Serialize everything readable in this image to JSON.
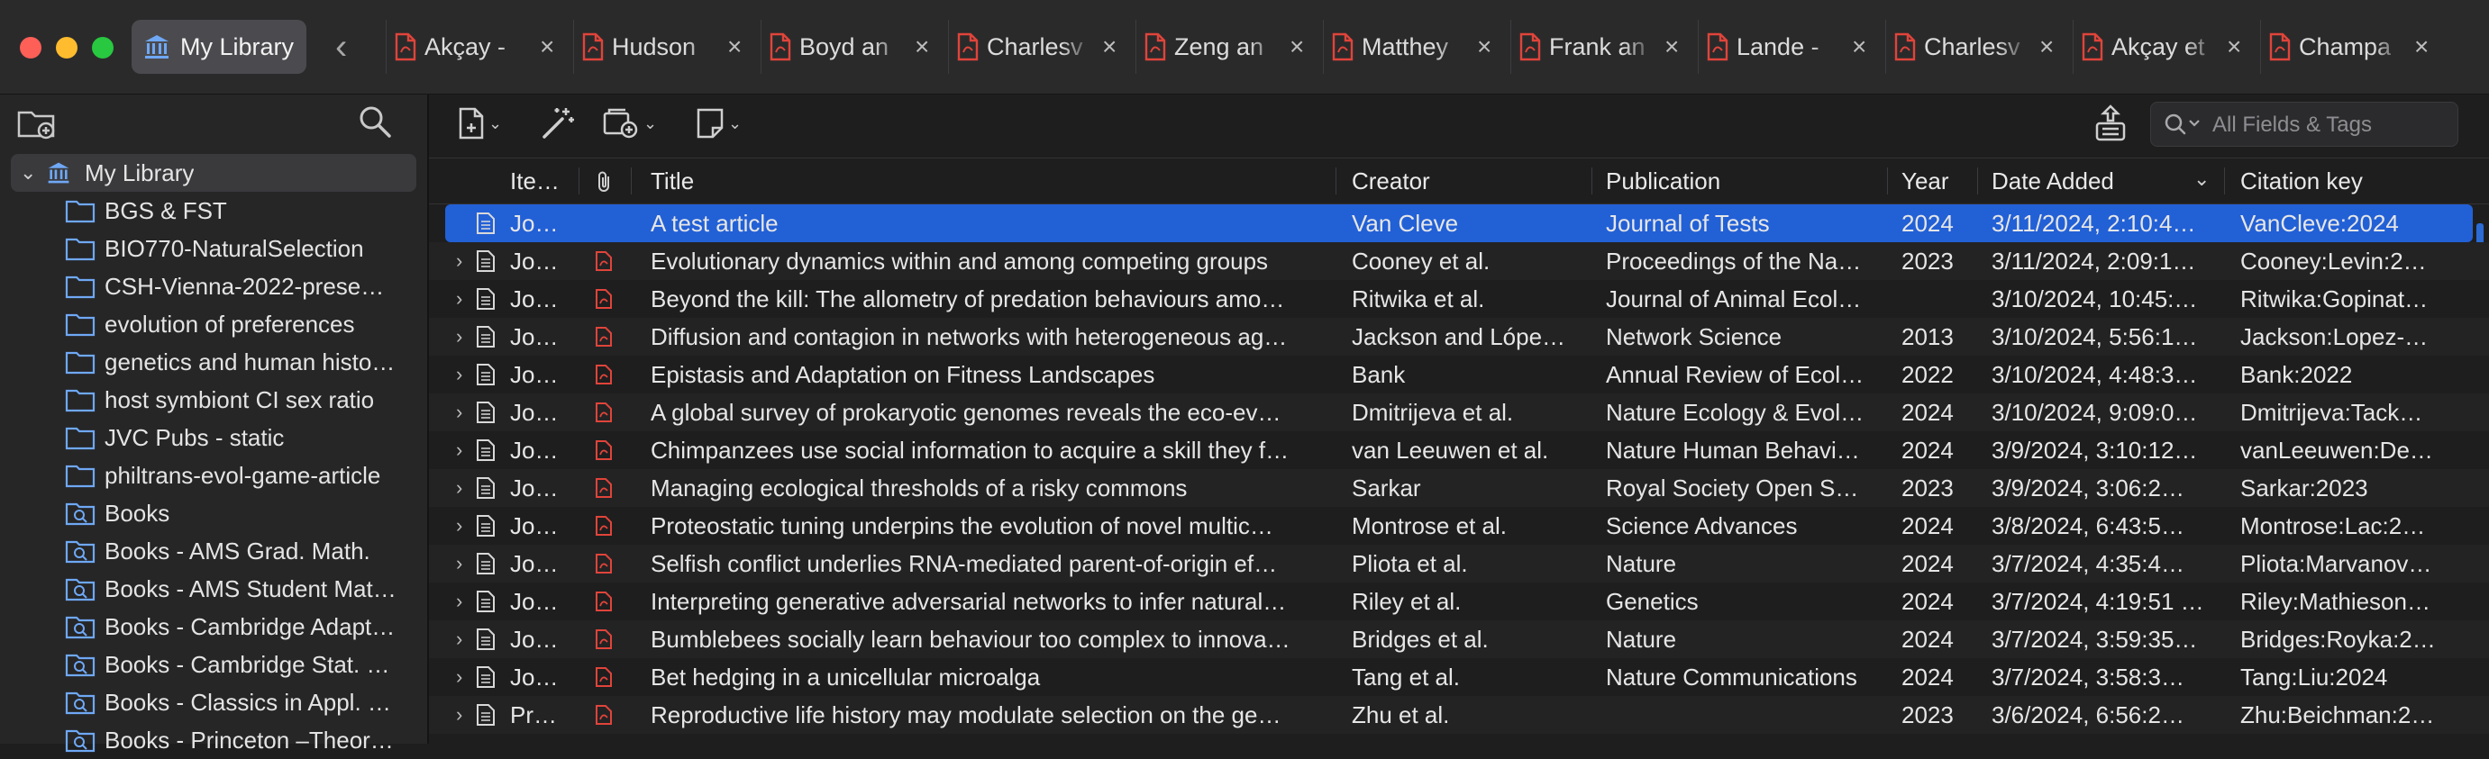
{
  "window": {
    "library_tab_label": "My Library",
    "tabs": [
      {
        "label": "Akçay - "
      },
      {
        "label": "Hudson"
      },
      {
        "label": "Boyd an"
      },
      {
        "label": "Charlesv"
      },
      {
        "label": "Zeng an"
      },
      {
        "label": "Matthey"
      },
      {
        "label": "Frank an"
      },
      {
        "label": "Lande - "
      },
      {
        "label": "Charlesv"
      },
      {
        "label": "Akçay et"
      },
      {
        "label": "Champa"
      }
    ]
  },
  "sidebar": {
    "root_label": "My Library",
    "items": [
      {
        "label": "BGS & FST",
        "icon": "folder-icon"
      },
      {
        "label": "BIO770-NaturalSelection",
        "icon": "folder-icon"
      },
      {
        "label": "CSH-Vienna-2022-prese…",
        "icon": "folder-icon"
      },
      {
        "label": "evolution of preferences",
        "icon": "folder-icon"
      },
      {
        "label": "genetics and human histo…",
        "icon": "folder-icon"
      },
      {
        "label": "host symbiont CI sex ratio",
        "icon": "folder-icon"
      },
      {
        "label": "JVC Pubs - static",
        "icon": "folder-icon"
      },
      {
        "label": "philtrans-evol-game-article",
        "icon": "folder-icon"
      },
      {
        "label": "Books",
        "icon": "saved-search-icon"
      },
      {
        "label": "Books - AMS Grad. Math.",
        "icon": "saved-search-icon"
      },
      {
        "label": "Books - AMS Student Mat…",
        "icon": "saved-search-icon"
      },
      {
        "label": "Books - Cambridge Adapt…",
        "icon": "saved-search-icon"
      },
      {
        "label": "Books - Cambridge Stat. …",
        "icon": "saved-search-icon"
      },
      {
        "label": "Books - Classics in Appl. …",
        "icon": "saved-search-icon"
      },
      {
        "label": "Books - Princeton –Theor…",
        "icon": "saved-search-icon"
      }
    ]
  },
  "search": {
    "placeholder": "All Fields & Tags"
  },
  "columns": {
    "item_type": "Ite…",
    "title": "Title",
    "creator": "Creator",
    "publication": "Publication",
    "year": "Year",
    "date_added": "Date Added",
    "citation_key": "Citation key"
  },
  "rows": [
    {
      "type": "Jo…",
      "title": "A test article",
      "creator": "Van Cleve",
      "publication": "Journal of Tests",
      "year": "2024",
      "date_added": "3/11/2024, 2:10:4…",
      "citation_key": "VanCleve:2024"
    },
    {
      "type": "Jo…",
      "title": "Evolutionary dynamics within and among competing groups",
      "creator": "Cooney et al.",
      "publication": "Proceedings of the Na…",
      "year": "2023",
      "date_added": "3/11/2024, 2:09:1…",
      "citation_key": "Cooney:Levin:2…"
    },
    {
      "type": "Jo…",
      "title": "Beyond the kill: The allometry of predation behaviours amo…",
      "creator": "Ritwika et al.",
      "publication": "Journal of Animal Ecol…",
      "year": "",
      "date_added": "3/10/2024, 10:45:…",
      "citation_key": "Ritwika:Gopinat…"
    },
    {
      "type": "Jo…",
      "title": "Diffusion and contagion in networks with heterogeneous ag…",
      "creator": "Jackson and Lópe…",
      "publication": "Network Science",
      "year": "2013",
      "date_added": "3/10/2024, 5:56:1…",
      "citation_key": "Jackson:Lopez-…"
    },
    {
      "type": "Jo…",
      "title": "Epistasis and Adaptation on Fitness Landscapes",
      "creator": "Bank",
      "publication": "Annual Review of Ecol…",
      "year": "2022",
      "date_added": "3/10/2024, 4:48:3…",
      "citation_key": "Bank:2022"
    },
    {
      "type": "Jo…",
      "title": "A global survey of prokaryotic genomes reveals the eco-ev…",
      "creator": "Dmitrijeva et al.",
      "publication": "Nature Ecology & Evol…",
      "year": "2024",
      "date_added": "3/10/2024, 9:09:0…",
      "citation_key": "Dmitrijeva:Tack…"
    },
    {
      "type": "Jo…",
      "title": "Chimpanzees use social information to acquire a skill they f…",
      "creator": "van Leeuwen et al.",
      "publication": "Nature Human Behavi…",
      "year": "2024",
      "date_added": "3/9/2024, 3:10:12…",
      "citation_key": "vanLeeuwen:De…"
    },
    {
      "type": "Jo…",
      "title": "Managing ecological thresholds of a risky commons",
      "creator": "Sarkar",
      "publication": "Royal Society Open S…",
      "year": "2023",
      "date_added": "3/9/2024, 3:06:2…",
      "citation_key": "Sarkar:2023"
    },
    {
      "type": "Jo…",
      "title": "Proteostatic tuning underpins the evolution of novel multic…",
      "creator": "Montrose et al.",
      "publication": "Science Advances",
      "year": "2024",
      "date_added": "3/8/2024, 6:43:5…",
      "citation_key": "Montrose:Lac:2…"
    },
    {
      "type": "Jo…",
      "title": "Selfish conflict underlies RNA-mediated parent-of-origin ef…",
      "creator": "Pliota et al.",
      "publication": "Nature",
      "year": "2024",
      "date_added": "3/7/2024, 4:35:4…",
      "citation_key": "Pliota:Marvanov…"
    },
    {
      "type": "Jo…",
      "title": "Interpreting generative adversarial networks to infer natural…",
      "creator": "Riley et al.",
      "publication": "Genetics",
      "year": "2024",
      "date_added": "3/7/2024, 4:19:51 …",
      "citation_key": "Riley:Mathieson…"
    },
    {
      "type": "Jo…",
      "title": "Bumblebees socially learn behaviour too complex to innova…",
      "creator": "Bridges et al.",
      "publication": "Nature",
      "year": "2024",
      "date_added": "3/7/2024, 3:59:35…",
      "citation_key": "Bridges:Royka:2…"
    },
    {
      "type": "Jo…",
      "title": "Bet hedging in a unicellular microalga",
      "creator": "Tang et al.",
      "publication": "Nature Communications",
      "year": "2024",
      "date_added": "3/7/2024, 3:58:3…",
      "citation_key": "Tang:Liu:2024"
    },
    {
      "type": "Pr…",
      "title": "Reproductive life history may modulate selection on the ge…",
      "creator": "Zhu et al.",
      "publication": "",
      "year": "2023",
      "date_added": "3/6/2024, 6:56:2…",
      "citation_key": "Zhu:Beichman:2…"
    }
  ],
  "colors": {
    "selection": "#2260d6",
    "pdf_red": "#e0443a",
    "folder_blue": "#6fa8f5"
  }
}
